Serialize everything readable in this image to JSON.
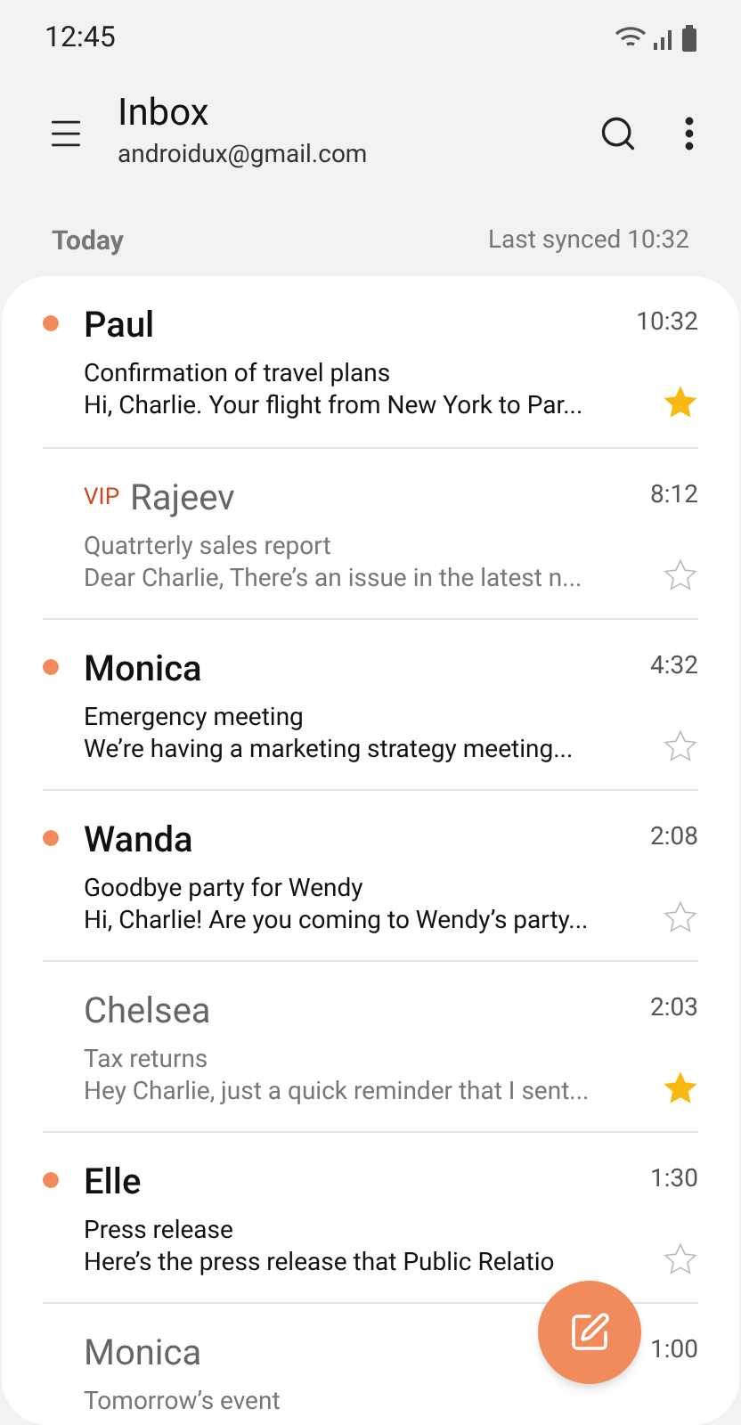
{
  "status_bar": {
    "time": "12:45"
  },
  "header": {
    "title": "Inbox",
    "account": "androidux@gmail.com"
  },
  "section": {
    "label": "Today",
    "synced": "Last synced 10:32"
  },
  "emails": [
    {
      "sender": "Paul",
      "vip": false,
      "unread": true,
      "time": "10:32",
      "subject": "Confirmation of travel plans",
      "preview": "Hi, Charlie. Your flight from New York to Par...",
      "starred": true
    },
    {
      "sender": "Rajeev",
      "vip": true,
      "vip_label": "VIP",
      "unread": false,
      "time": "8:12",
      "subject": "Quatrterly sales report",
      "preview": "Dear Charlie, There’s an issue in the latest n...",
      "starred": false
    },
    {
      "sender": "Monica",
      "vip": false,
      "unread": true,
      "time": "4:32",
      "subject": "Emergency meeting",
      "preview": "We’re having a marketing strategy meeting...",
      "starred": false
    },
    {
      "sender": "Wanda",
      "vip": false,
      "unread": true,
      "time": "2:08",
      "subject": "Goodbye party for Wendy",
      "preview": "Hi, Charlie! Are you coming to Wendy’s party...",
      "starred": false
    },
    {
      "sender": "Chelsea",
      "vip": false,
      "unread": false,
      "time": "2:03",
      "subject": "Tax returns",
      "preview": "Hey Charlie, just a quick reminder that I sent...",
      "starred": true
    },
    {
      "sender": "Elle",
      "vip": false,
      "unread": true,
      "time": "1:30",
      "subject": "Press release",
      "preview": "Here’s the press release that Public Relatio",
      "starred": false
    },
    {
      "sender": "Monica",
      "unread": false,
      "time": "1:00",
      "subject": "Tomorrow’s event"
    }
  ]
}
